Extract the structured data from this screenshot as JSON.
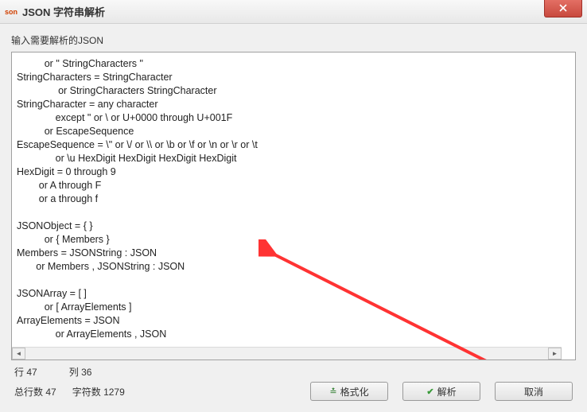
{
  "window": {
    "icon_text": "son",
    "title": "JSON 字符串解析"
  },
  "label": "输入需要解析的JSON",
  "text_content": "          or \" StringCharacters \"\nStringCharacters = StringCharacter\n               or StringCharacters StringCharacter\nStringCharacter = any character\n              except \" or \\ or U+0000 through U+001F\n          or EscapeSequence\nEscapeSequence = \\\" or \\/ or \\\\ or \\b or \\f or \\n or \\r or \\t\n              or \\u HexDigit HexDigit HexDigit HexDigit\nHexDigit = 0 through 9\n        or A through F\n        or a through f\n\nJSONObject = { }\n          or { Members }\nMembers = JSONString : JSON\n       or Members , JSONString : JSON\n\nJSONArray = [ ]\n          or [ ArrayElements ]\nArrayElements = JSON\n              or ArrayElements , JSON",
  "status": {
    "line_label": "行",
    "line_value": "47",
    "col_label": "列",
    "col_value": "36",
    "total_lines_label": "总行数",
    "total_lines_value": "47",
    "char_count_label": "字符数",
    "char_count_value": "1279"
  },
  "buttons": {
    "format": "格式化",
    "parse": "解析",
    "cancel": "取消"
  }
}
